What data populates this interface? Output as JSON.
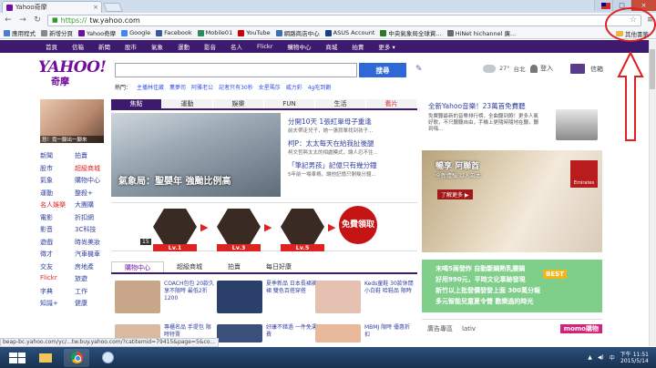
{
  "browser": {
    "tab_title": "Yahoo奇摩",
    "tab_close": "×",
    "url_https": "https://",
    "url_rest": "tw.yahoo.com",
    "win_min": "–",
    "win_max": "□",
    "win_close": "×"
  },
  "bookmarks": {
    "items": [
      "應用程式",
      "新增分頁",
      "Yahoo奇摩",
      "Google",
      "Facebook",
      "Mobile01",
      "YouTube",
      "網路商店中心",
      "ASUS Account",
      "中央氣象局全球資...",
      "HiNet hichannel 廣..."
    ],
    "colors": [
      "#4a7fd0",
      "#888888",
      "#720e9e",
      "#4285f4",
      "#3b5998",
      "#2e8b57",
      "#cc0000",
      "#3a6fb0",
      "#1a3f8a",
      "#2a7a2a",
      "#6a6a6a"
    ],
    "other": "其他書籤"
  },
  "ynav": {
    "items": [
      "首頁",
      "信箱",
      "新聞",
      "股市",
      "氣象",
      "運動",
      "影音",
      "名人",
      "Flickr",
      "購物中心",
      "商城",
      "拍賣",
      "更多 ▾"
    ]
  },
  "header": {
    "logo": "YAHOO!",
    "logo_sub": "奇摩",
    "search_button": "搜尋",
    "trending_label": "熱門：",
    "trending": [
      "主播林佳葳",
      "薰夢司",
      "阿雅老公",
      "記者只有30秒",
      "女星瑪莎",
      "威力彩",
      "4g吃到飽"
    ],
    "temperature": "27°",
    "city": "台北",
    "login": "登入",
    "mail": "信箱"
  },
  "left": {
    "avatar_caption": "怒！竟一腳出一腳來",
    "nav": [
      {
        "label": "新聞",
        "red": false
      },
      {
        "label": "拍賣",
        "red": false
      },
      {
        "label": "股市",
        "red": false
      },
      {
        "label": "超級商城",
        "red": true
      },
      {
        "label": "氣象",
        "red": false
      },
      {
        "label": "購物中心",
        "red": false
      },
      {
        "label": "運動",
        "red": false
      },
      {
        "label": "整殺+",
        "red": false
      },
      {
        "label": "名人娛樂",
        "red": true
      },
      {
        "label": "大團購",
        "red": false
      },
      {
        "label": "電影",
        "red": false
      },
      {
        "label": "折扣網",
        "red": false
      },
      {
        "label": "影音",
        "red": false
      },
      {
        "label": "3C科技",
        "red": false
      },
      {
        "label": "遊戲",
        "red": false
      },
      {
        "label": "時尚美妝",
        "red": false
      },
      {
        "label": "徵才",
        "red": false
      },
      {
        "label": "汽車機車",
        "red": false
      },
      {
        "label": "交友",
        "red": false
      },
      {
        "label": "房地產",
        "red": false
      },
      {
        "label": "Flickr",
        "red": true
      },
      {
        "label": "旅遊",
        "red": false
      },
      {
        "label": "字典",
        "red": false
      },
      {
        "label": "工作",
        "red": false
      },
      {
        "label": "知識+",
        "red": false
      },
      {
        "label": "健康",
        "red": false
      }
    ]
  },
  "main": {
    "tabs": [
      {
        "label": "焦點",
        "active": true,
        "red": false
      },
      {
        "label": "運動",
        "active": false,
        "red": false
      },
      {
        "label": "娛樂",
        "active": false,
        "red": false
      },
      {
        "label": "FUN",
        "active": false,
        "red": false
      },
      {
        "label": "生活",
        "active": false,
        "red": false
      },
      {
        "label": "看片",
        "active": false,
        "red": true
      }
    ],
    "hero_caption": "氣象局：聖嬰年 強颱比例高",
    "news": [
      {
        "title": "分開10天 1張紅單母子重逢",
        "desc": "前夫帶走兒子，她一張罰單找到孩子..."
      },
      {
        "title": "柯P：太太每天在給我扯後腿",
        "desc": "柯文哲與太太的相處模式，讓人忍不住..."
      },
      {
        "title": "「筆記男孩」記億只有幾分鐘",
        "desc": "5年前一場車禍，讓他記憶只剩幾分鐘..."
      }
    ],
    "levels": [
      "Lv.1",
      "Lv.3",
      "Lv.5"
    ],
    "free_badge": "免費領取",
    "banner_num": "15",
    "shop_tabs": [
      {
        "label": "購物中心",
        "active": true
      },
      {
        "label": "超級商城",
        "active": false
      },
      {
        "label": "拍賣",
        "active": false
      },
      {
        "label": "每日好康",
        "active": false
      }
    ],
    "products": [
      {
        "text": "COACH包包 20款久享不限時 最低2折 1200",
        "color": "#c8a68a"
      },
      {
        "text": "夏季新品 日本長裙褲裙 雙色百搭穿搭",
        "color": "#2a3f6a"
      },
      {
        "text": "Keds童鞋 30款休閒小白鞋 哈鞋品 限時",
        "color": "#e3c0b0"
      },
      {
        "text": "專櫃名品 手提包 限時特賣",
        "color": "#d9b9a0"
      },
      {
        "text": "好康不錯過 一件免運費",
        "color": "#3a4f7a"
      },
      {
        "text": "MBMJ 限時 優惠折扣",
        "color": "#e8b89a"
      }
    ]
  },
  "right": {
    "ad1_title": "全新Yahoo音樂！23萬首免費聽",
    "ad1_text": "免費聽最新的音樂排行榜，全曲聽到飽！更多人氣好歌，不只聽聽自由，手機上更隨時隨地在聽，聽到嗨...",
    "ad2_t1": "暢享 阿聯酋",
    "ad2_t2": "全新體驗 以人為本",
    "ad2_btn": "了解更多 ▶",
    "ad2_brand": "Emirates",
    "ad3_lines": [
      "末喝5兩發炸 自動斷鍋熱乳腰鍋",
      "好用990元，平時文化事跡發現",
      "新竹以上批發價發發上面 300萬分報",
      "多元智能兒童夏令營 歡樂過的時光"
    ],
    "ad3_best": "BEST",
    "bottom_label": "廣告專區",
    "bottom_lativ": "lativ",
    "bottom_momo": "momo購物"
  },
  "status_url": "beap-bc.yahoo.com/yc/...tw.buy.yahoo.com/?catitemid=79415&page=5&co...",
  "taskbar": {
    "lang": "中",
    "time": "下午 11:51",
    "date": "2015/5/14"
  }
}
